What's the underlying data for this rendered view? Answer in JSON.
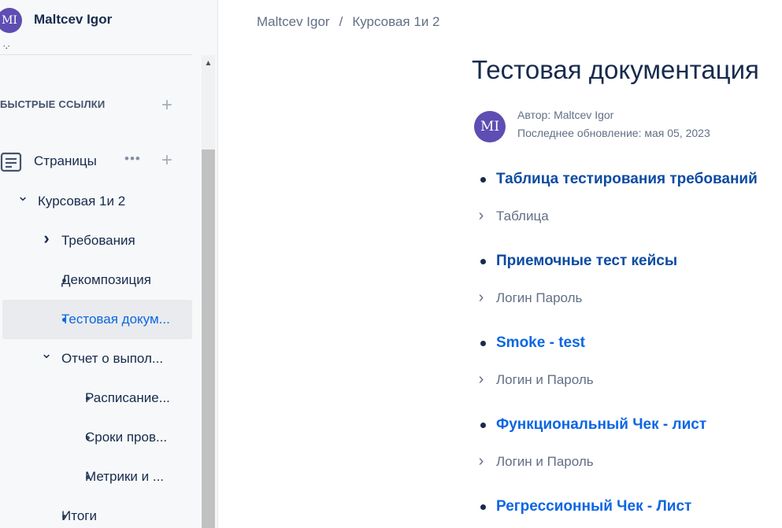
{
  "space": {
    "avatar_initials": "MI",
    "title": "Maltcev Igor"
  },
  "sidebar": {
    "quick_links_label": "БЫСТРЫЕ ССЫЛКИ",
    "pages_label": "Страницы",
    "tree": [
      {
        "label": "Курсовая 1и 2",
        "kind": "expanded"
      },
      {
        "label": "Требования",
        "kind": "collapsed"
      },
      {
        "label": "Декомпозиция",
        "kind": "leaf"
      },
      {
        "label": "Тестовая докум...",
        "kind": "leaf",
        "selected": true
      },
      {
        "label": "Отчет о выпол...",
        "kind": "expanded"
      },
      {
        "label": "Расписание...",
        "kind": "leaf"
      },
      {
        "label": "Сроки пров...",
        "kind": "leaf"
      },
      {
        "label": "Метрики и ...",
        "kind": "leaf"
      },
      {
        "label": "Итоги",
        "kind": "leaf"
      }
    ]
  },
  "breadcrumb": {
    "items": [
      "Maltcev Igor",
      "Курсовая 1и 2"
    ],
    "separator": "/"
  },
  "page": {
    "title": "Тестовая документация",
    "author_avatar_initials": "MI",
    "author": "Автор: Maltcev Igor",
    "updated": "Последнее обновление: мая 05, 2023"
  },
  "content": [
    {
      "link": "Таблица тестирования требований",
      "expand": "Таблица"
    },
    {
      "link": "Приемочные тест кейсы",
      "expand": "Логин Пароль"
    },
    {
      "link": "Smoke - test",
      "expand": "Логин и Пароль"
    },
    {
      "link": "Функциональный Чек - лист",
      "expand": "Логин и Пароль"
    },
    {
      "link": "Регрессионный  Чек - Лист"
    }
  ],
  "colors": {
    "avatar": "#5e4db2",
    "link": "#0c4ba3",
    "selected": "#0c66e4"
  }
}
